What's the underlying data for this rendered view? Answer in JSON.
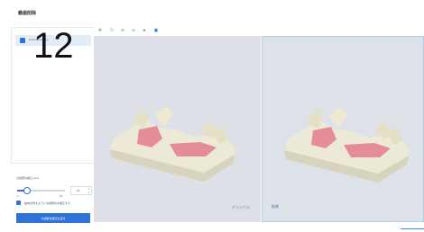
{
  "header": {
    "title": "義歯削除"
  },
  "overlay_number": "12",
  "list": {
    "items": [
      {
        "label": "Defektabteilung",
        "checked": true
      }
    ]
  },
  "params": {
    "label": "欠損部位補正(mm)",
    "slider": {
      "min": "0",
      "max": "50",
      "value_fraction": 0.2
    },
    "value": "10",
    "option_label": "歯肉を残すように欠損部位を補正する",
    "run_button": "欠損部位補正を実行"
  },
  "toolbar": {
    "icons": [
      "move-icon",
      "rotate-icon",
      "zoom-in-icon",
      "zoom-out-icon",
      "color-icon",
      "layout-icon"
    ]
  },
  "viewports": {
    "left_label": "オリジナル",
    "right_label": "結果"
  },
  "colors": {
    "accent": "#2f72d8",
    "model_base": "#ece9d6",
    "gum": "#e58d96",
    "background": "#dde1e7"
  }
}
